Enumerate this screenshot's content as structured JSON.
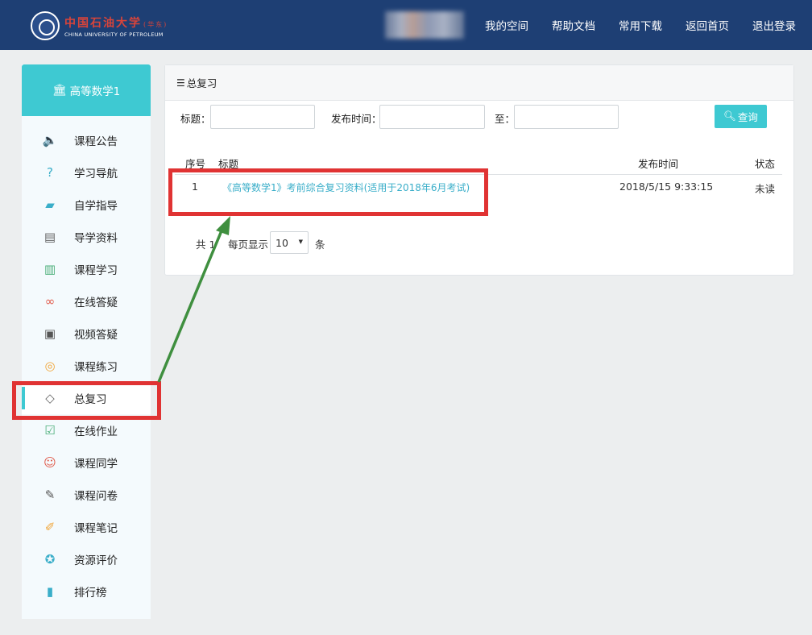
{
  "header": {
    "logo_cn": "中国石油大学",
    "logo_cn_sub": "(华东)",
    "logo_en": "CHINA UNIVERSITY OF PETROLEUM",
    "nav": [
      "我的空间",
      "帮助文档",
      "常用下载",
      "返回首页",
      "退出登录"
    ]
  },
  "sidebar": {
    "course_title": "高等数学1",
    "items": [
      {
        "label": "课程公告",
        "icon": "speaker-icon",
        "glyph": "🔈"
      },
      {
        "label": "学习导航",
        "icon": "question-icon",
        "glyph": "?"
      },
      {
        "label": "自学指导",
        "icon": "guide-icon",
        "glyph": "▰"
      },
      {
        "label": "导学资料",
        "icon": "clipboard-icon",
        "glyph": "▤"
      },
      {
        "label": "课程学习",
        "icon": "document-icon",
        "glyph": "▥"
      },
      {
        "label": "在线答疑",
        "icon": "chat-icon",
        "glyph": "∞"
      },
      {
        "label": "视频答疑",
        "icon": "film-icon",
        "glyph": "▣"
      },
      {
        "label": "课程练习",
        "icon": "compass-icon",
        "glyph": "◎"
      },
      {
        "label": "总复习",
        "icon": "layers-icon",
        "glyph": "◇"
      },
      {
        "label": "在线作业",
        "icon": "checklist-icon",
        "glyph": "☑"
      },
      {
        "label": "课程同学",
        "icon": "people-icon",
        "glyph": "☺"
      },
      {
        "label": "课程问卷",
        "icon": "survey-icon",
        "glyph": "✎"
      },
      {
        "label": "课程笔记",
        "icon": "notebook-icon",
        "glyph": "✐"
      },
      {
        "label": "资源评价",
        "icon": "badge-icon",
        "glyph": "✪"
      },
      {
        "label": "排行榜",
        "icon": "bar-chart-icon",
        "glyph": "▮"
      }
    ],
    "active_index": 8
  },
  "panel": {
    "title": "总复习",
    "filter": {
      "title_label": "标题：",
      "date_label": "发布时间：",
      "to_label": "至：",
      "title_value": "",
      "date_from_value": "",
      "date_to_value": "",
      "search_label": "查询"
    },
    "table": {
      "headers": {
        "index": "序号",
        "title": "标题",
        "date": "发布时间",
        "status": "状态"
      },
      "rows": [
        {
          "index": "1",
          "title": "《高等数学1》考前综合复习资料(适用于2018年6月考试)",
          "date": "2018/5/15 9:33:15",
          "status": "未读"
        }
      ]
    },
    "pager": {
      "total_prefix": "共 1",
      "per_page_label": "每页显示",
      "per_page": "10",
      "unit": "条"
    }
  },
  "colors": {
    "header_bg": "#1e3f74",
    "accent": "#3ec9d2",
    "link": "#3aaec9",
    "annotation": "#e03333",
    "arrow": "#3f8f3f"
  }
}
